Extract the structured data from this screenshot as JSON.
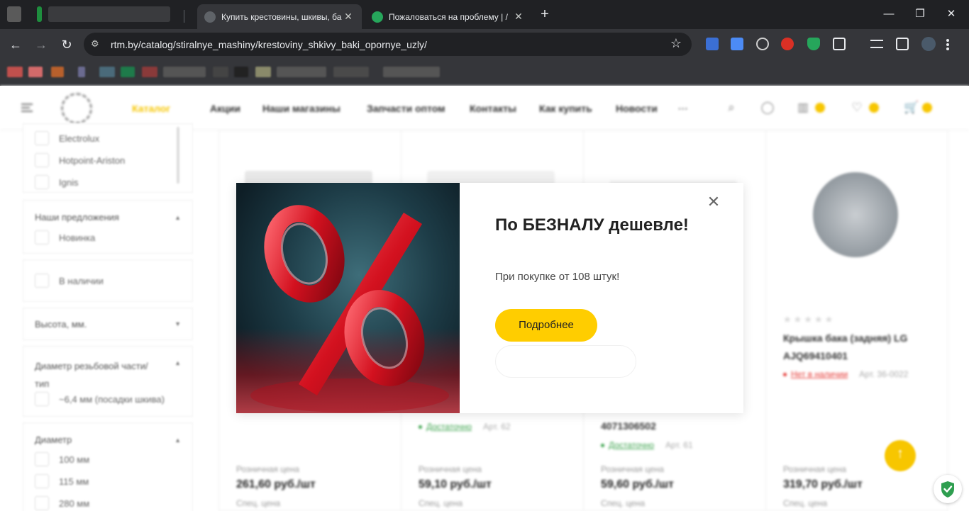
{
  "browser": {
    "tabs": [
      {
        "title": "Купить крестовины, шкивы, ба",
        "active": true
      },
      {
        "title": "Пожаловаться на проблему | /",
        "active": false
      }
    ],
    "new_tab": "+",
    "url": "rtm.by/catalog/stiralnye_mashiny/krestoviny_shkivy_baki_opornye_uzly/",
    "controls": {
      "minimize": "—",
      "maximize": "❐",
      "close": "✕",
      "tab_close": "✕"
    },
    "nav": {
      "back": "←",
      "forward": "→",
      "reload": "↻",
      "star": "☆",
      "site_info": "⚙"
    },
    "extensions": [
      "password-manager-icon",
      "translate-icon",
      "vpn-icon",
      "help-icon",
      "shield-icon",
      "puzzle-icon",
      "media-icon",
      "sidebar-icon",
      "profile-icon",
      "menu-icon"
    ]
  },
  "site": {
    "nav": {
      "catalog": "Каталог",
      "items": [
        "Акции",
        "Наши магазины",
        "Запчасти оптом",
        "Контакты",
        "Как купить",
        "Новости"
      ],
      "more": "···"
    },
    "icons": {
      "search": "⌕",
      "account": "◯",
      "compare": "▥",
      "favorites": "♡",
      "cart": "🛒"
    },
    "accent": "#f7c600"
  },
  "sidebar": {
    "brands": [
      "Electrolux",
      "Hotpoint-Ariston",
      "Ignis"
    ],
    "offers": {
      "title": "Наши предложения",
      "items": [
        "Новинка"
      ]
    },
    "in_stock": "В наличии",
    "height": {
      "title": "Высота, мм."
    },
    "thread": {
      "title": "Диаметр резьбовой части/тип",
      "items": [
        "~6,4 мм (посадки шкива)"
      ]
    },
    "diameter": {
      "title": "Диаметр",
      "items": [
        "100 мм",
        "115 мм",
        "280 мм"
      ]
    }
  },
  "products": [
    {
      "name": "",
      "stock": "",
      "article": "",
      "price_label": "Розничная цена",
      "price": "261,60 руб./шт",
      "spec_label": "Спец. цена"
    },
    {
      "name": "",
      "stock": "Достаточно",
      "article": "Арт. 62",
      "price_label": "Розничная цена",
      "price": "59,10 руб./шт",
      "spec_label": "Спец. цена"
    },
    {
      "name": "4071306502",
      "stock": "Достаточно",
      "article": "Арт. 61",
      "price_label": "Розничная цена",
      "price": "59,60 руб./шт",
      "spec_label": "Спец. цена"
    },
    {
      "name": "Крышка бака (задняя) LG AJQ69410401",
      "stars": "★★★★★",
      "stock": "Нет в наличии",
      "article": "Арт. 36-0022",
      "price_label": "Розничная цена",
      "price": "319,70 руб./шт",
      "spec_label": "Спец. цена"
    }
  ],
  "modal": {
    "title": "По БЕЗНАЛУ дешевле!",
    "subtitle": "При покупке от 108 штук!",
    "button": "Подробнее",
    "close": "✕",
    "image_symbol": "%"
  }
}
